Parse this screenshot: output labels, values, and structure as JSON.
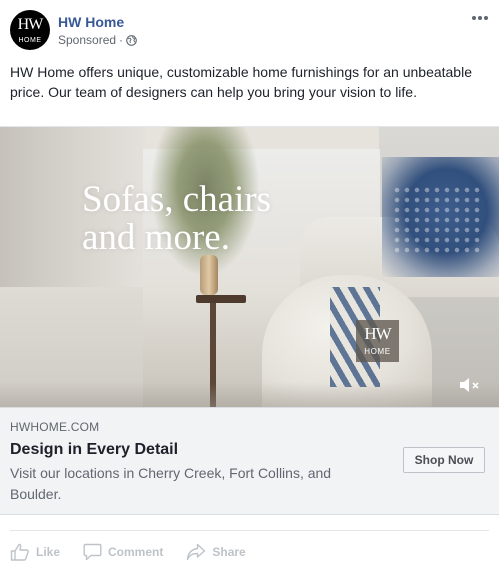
{
  "header": {
    "page_name": "HW Home",
    "sponsored": "Sponsored",
    "separator": "·",
    "avatar_text": {
      "top": "HW",
      "bottom": "HOME"
    }
  },
  "post": {
    "text": "HW Home offers unique, customizable home furnishings for an unbeatable price. Our team of designers can help you bring your vision to life."
  },
  "media": {
    "headline_line1": "Sofas, chairs",
    "headline_line2": "and more.",
    "logo_top": "HW",
    "logo_bottom": "HOME"
  },
  "link": {
    "domain": "HWHOME.COM",
    "title": "Design in Every Detail",
    "description": "Visit our locations in Cherry Creek, Fort Collins, and Boulder.",
    "cta": "Shop Now"
  },
  "actions": {
    "like": "Like",
    "comment": "Comment",
    "share": "Share"
  },
  "icons": [
    "globe-icon",
    "more-icon",
    "mute-icon",
    "like-icon",
    "comment-icon",
    "share-icon"
  ],
  "colors": {
    "page_name": "#385898",
    "muted_text": "#606770",
    "action_text": "#bec3c9",
    "link_bg": "#f2f3f5"
  }
}
